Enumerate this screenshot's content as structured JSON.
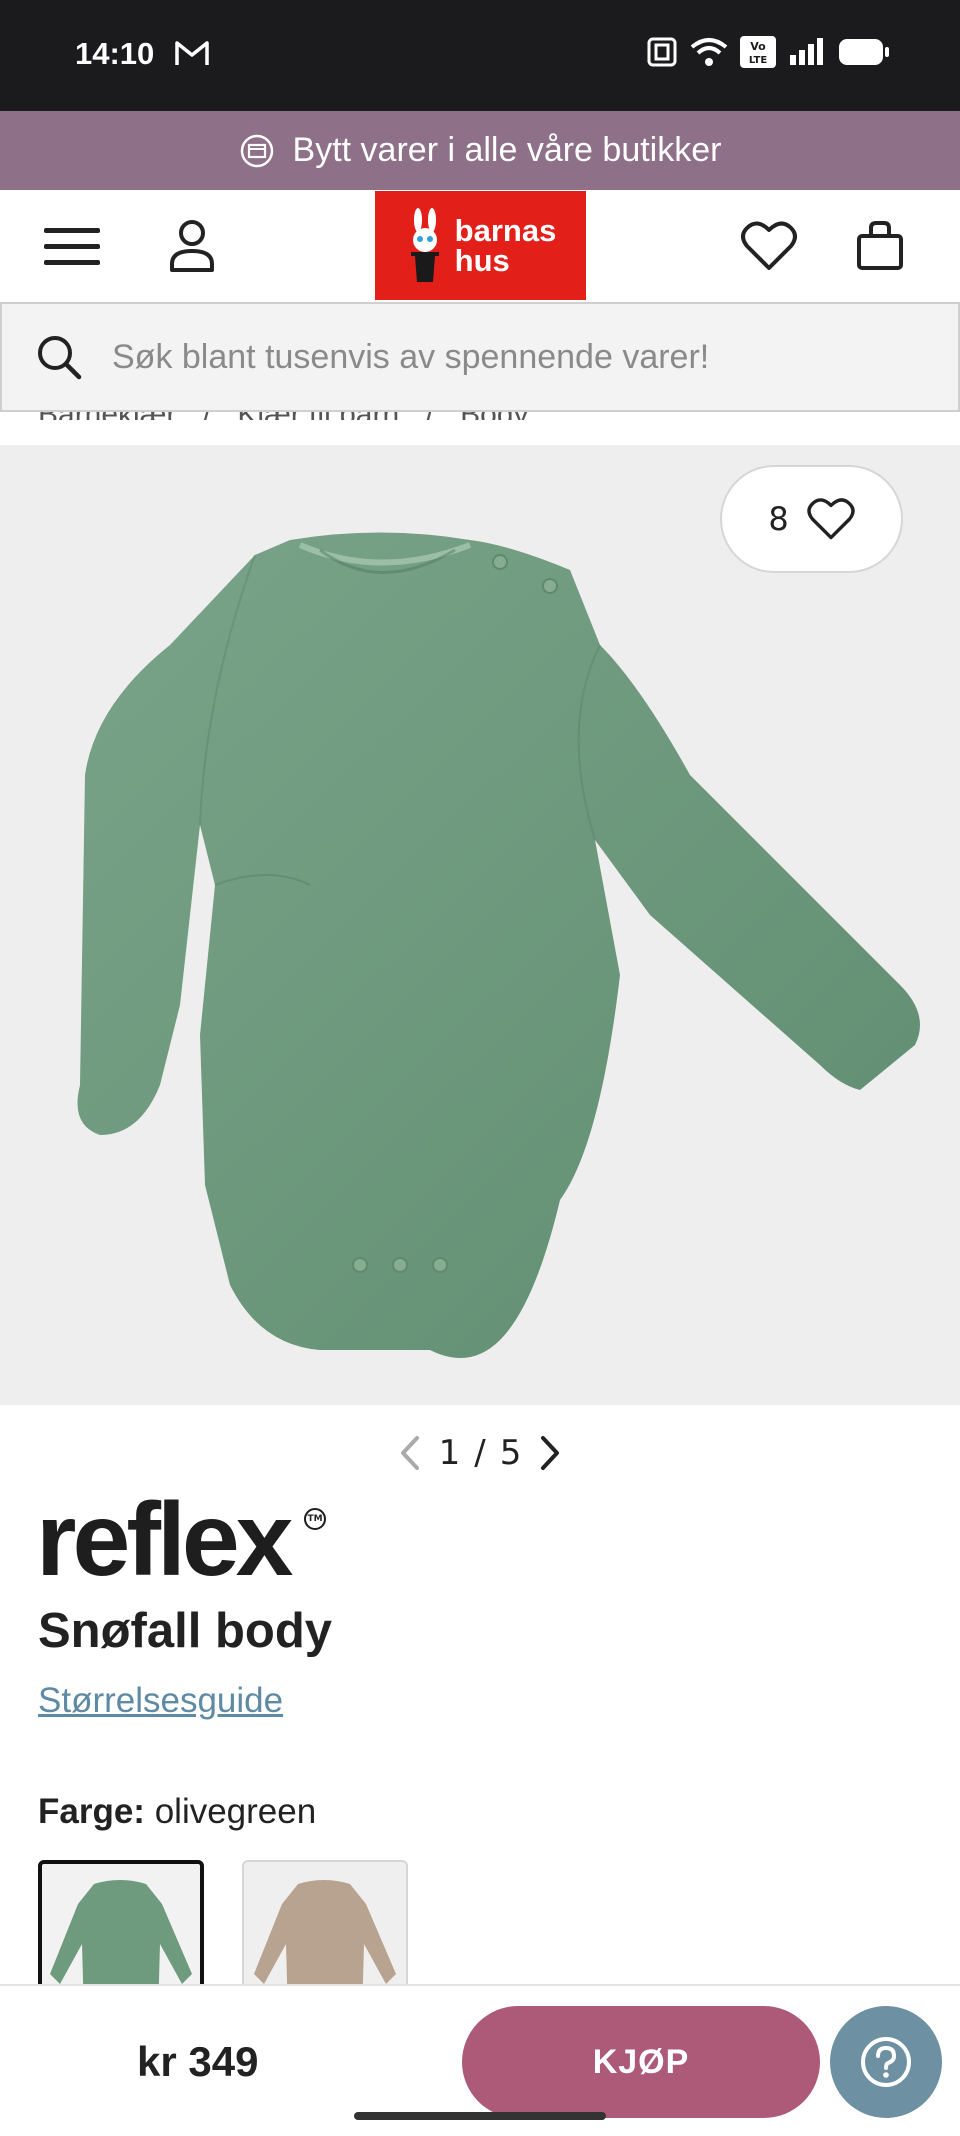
{
  "status_bar": {
    "time": "14:10"
  },
  "promo_banner": {
    "text": "Bytt varer i alle våre butikker"
  },
  "logo": {
    "line1": "barnas",
    "line2": "hus"
  },
  "search": {
    "placeholder": "Søk blant tusenvis av spennende varer!"
  },
  "breadcrumb": [
    "Barneklær",
    "/",
    "Klær til barn",
    "/",
    "Body"
  ],
  "gallery": {
    "favorites_count": "8",
    "current": "1",
    "separator": "/",
    "total": "5"
  },
  "product": {
    "brand": "reflex",
    "brand_tm": "TM",
    "title": "Snøfall body",
    "size_guide": "Størrelsesguide",
    "color_label": "Farge:",
    "color_value": "olivegreen",
    "swatches": [
      {
        "name": "olivegreen",
        "color": "#6e9a7e"
      },
      {
        "name": "beige",
        "color": "#b8a391"
      }
    ]
  },
  "buy_bar": {
    "price": "kr 349",
    "buy_label": "KJØP"
  },
  "colors": {
    "promo_bg": "#8e7088",
    "logo_red": "#e21f19",
    "buy_button": "#ac5a78",
    "help_button": "#6e90a3",
    "garment_green": "#6e9a7e"
  }
}
